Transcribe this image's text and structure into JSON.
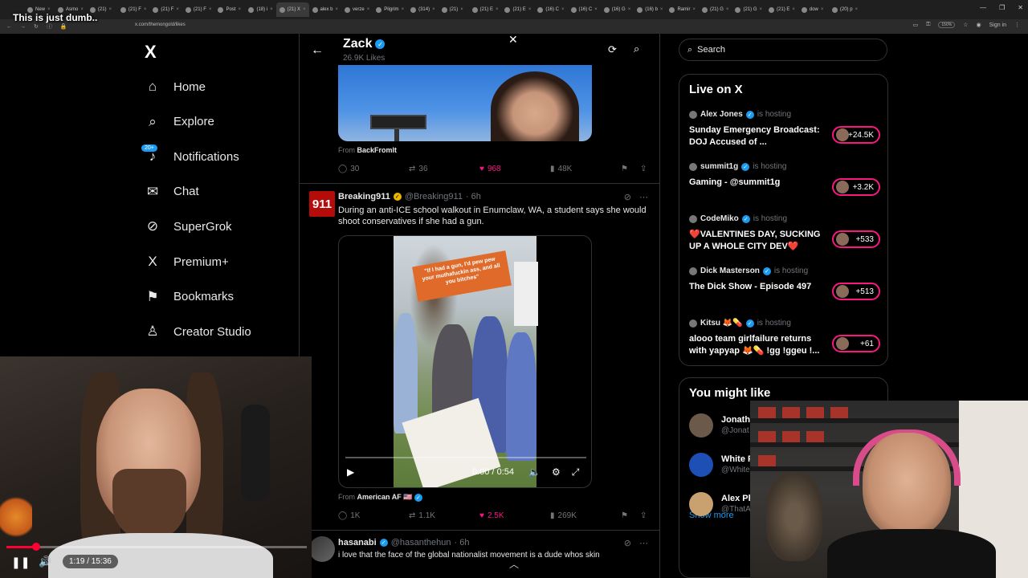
{
  "overlay_caption": "This is just dumb..",
  "browser": {
    "tabs": [
      {
        "label": "New",
        "active": false
      },
      {
        "label": "Asmo",
        "active": false
      },
      {
        "label": "(21)",
        "active": false
      },
      {
        "label": "(21) F",
        "active": false
      },
      {
        "label": "(21) F",
        "active": false
      },
      {
        "label": "(21) F",
        "active": false
      },
      {
        "label": "Post",
        "active": false
      },
      {
        "label": "(18) i",
        "active": false
      },
      {
        "label": "(21) X",
        "active": true
      },
      {
        "label": "alex b",
        "active": false
      },
      {
        "label": "verze",
        "active": false
      },
      {
        "label": "Pilgrim",
        "active": false
      },
      {
        "label": "(314)",
        "active": false
      },
      {
        "label": "(21)",
        "active": false
      },
      {
        "label": "(21) E",
        "active": false
      },
      {
        "label": "(21) E",
        "active": false
      },
      {
        "label": "(16) C",
        "active": false
      },
      {
        "label": "(16) C",
        "active": false
      },
      {
        "label": "(16) G",
        "active": false
      },
      {
        "label": "(16) b",
        "active": false
      },
      {
        "label": "Ramir",
        "active": false
      },
      {
        "label": "(21) G",
        "active": false
      },
      {
        "label": "(21) G",
        "active": false
      },
      {
        "label": "(21) E",
        "active": false
      },
      {
        "label": "dow",
        "active": false
      },
      {
        "label": "(20) p",
        "active": false
      }
    ],
    "url": "x.com/themongold/likes",
    "zoom": "150%",
    "sign_in": "Sign in"
  },
  "sidebar": {
    "logo": "X",
    "notif_badge": "20+",
    "items": [
      {
        "label": "Home",
        "icon": "home-icon",
        "glyph": "⌂",
        "name": "home"
      },
      {
        "label": "Explore",
        "icon": "search-icon",
        "glyph": "⌕",
        "name": "explore"
      },
      {
        "label": "Notifications",
        "icon": "bell-icon",
        "glyph": "♪",
        "name": "notifications"
      },
      {
        "label": "Chat",
        "icon": "mail-icon",
        "glyph": "✉",
        "name": "chat"
      },
      {
        "label": "SuperGrok",
        "icon": "grok-icon",
        "glyph": "⊘",
        "name": "supergrok"
      },
      {
        "label": "Premium+",
        "icon": "x-premium-icon",
        "glyph": "X",
        "name": "premium"
      },
      {
        "label": "Bookmarks",
        "icon": "bookmark-icon",
        "glyph": "⚑",
        "name": "bookmarks"
      },
      {
        "label": "Creator Studio",
        "icon": "creator-icon",
        "glyph": "♙",
        "name": "creator-studio"
      }
    ]
  },
  "header": {
    "name": "Zack",
    "subtitle": "26.9K Likes"
  },
  "tweets": [
    {
      "from_label": "From",
      "from_source": "BackFromIt",
      "replies": "30",
      "reposts": "36",
      "likes": "968",
      "views": "48K"
    },
    {
      "author": "Breaking911",
      "handle": "@Breaking911",
      "time": "· 6h",
      "avatar_text": "911",
      "text": "During an anti-ICE school walkout in Enumclaw, WA, a student says she would shoot conservatives if she had a gun.",
      "video_caption": "\"If I had a gun, I'd pew pew your muthafuckin ass, and all you bitches\"",
      "video_time": "0:00 / 0:54",
      "from_label": "From",
      "from_source": "American AF 🇺🇸",
      "replies": "1K",
      "reposts": "1.1K",
      "likes": "2.5K",
      "views": "269K"
    },
    {
      "author": "hasanabi",
      "handle": "@hasanthehun",
      "time": "· 6h",
      "text": "i love that the face of the global nationalist movement is a dude whos skin"
    }
  ],
  "right": {
    "search_placeholder": "Search",
    "live_title": "Live on X",
    "hosting_label": "is hosting",
    "live": [
      {
        "host": "Alex Jones",
        "title": "Sunday Emergency Broadcast: DOJ Accused of ...",
        "count": "+24.5K"
      },
      {
        "host": "summit1g",
        "title": "Gaming - @summit1g",
        "count": "+3.2K"
      },
      {
        "host": "CodeMiko",
        "title": "❤️VALENTINES DAY, SUCKING UP A WHOLE CITY DEV❤️",
        "count": "+533"
      },
      {
        "host": "Dick Masterson",
        "title": "The Dick Show - Episode 497",
        "count": "+513"
      },
      {
        "host": "Kitsu 🦊💊",
        "title": "alooo team girlfailure returns with yapyap 🦊💊 !gg !ggeu !...",
        "count": "+61"
      }
    ],
    "might_like_title": "You might like",
    "might_like": [
      {
        "name": "Jonatha",
        "handle": "@Jonat"
      },
      {
        "name": "White P",
        "handle": "@White"
      },
      {
        "name": "Alex Ph",
        "handle": "@ThatA"
      }
    ],
    "show_more": "Show more"
  },
  "player": {
    "time": "1:19 / 15:36",
    "progress": 0.084
  },
  "colors": {
    "accent": "#1d9bf0",
    "like": "#f91880",
    "player_red": "#ff0033"
  }
}
